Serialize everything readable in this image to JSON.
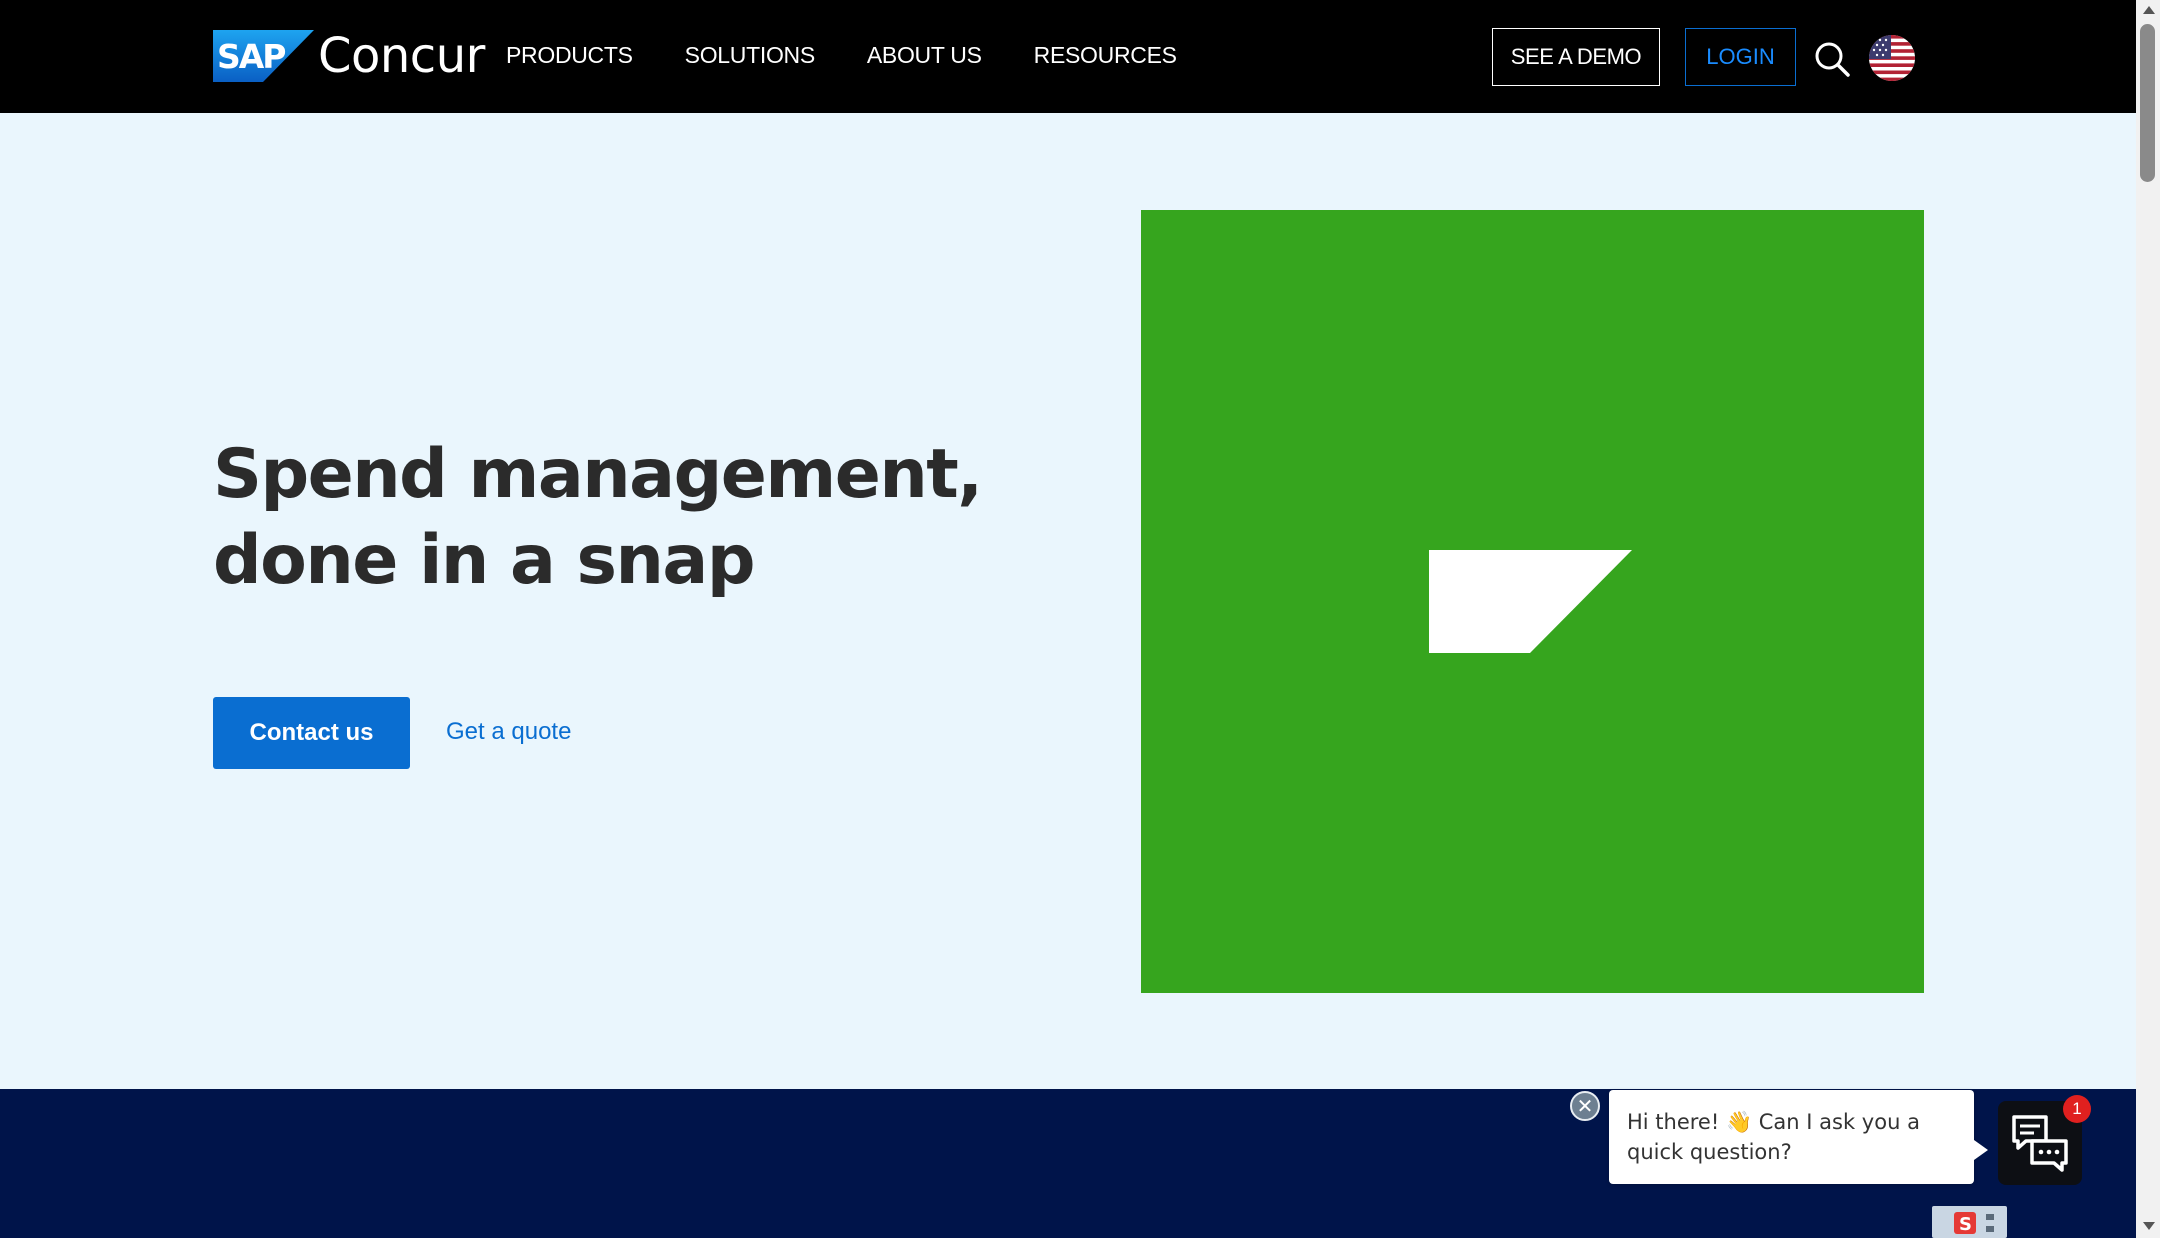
{
  "header": {
    "brand_sap": "SAP",
    "brand_name": "Concur",
    "nav": [
      {
        "label": "PRODUCTS"
      },
      {
        "label": "SOLUTIONS"
      },
      {
        "label": "ABOUT US"
      },
      {
        "label": "RESOURCES"
      }
    ],
    "demo_label": "SEE A DEMO",
    "login_label": "LOGIN",
    "search_icon": "search-icon",
    "region_icon": "us-flag-icon"
  },
  "hero": {
    "title_line1": "Spend management,",
    "title_line2": "done in a snap",
    "contact_label": "Contact us",
    "quote_label": "Get a quote",
    "image_color": "#36a51e"
  },
  "chat": {
    "greeting": "Hi there! 👋 Can I ask you a quick question?",
    "badge_count": "1",
    "close_icon": "close-icon",
    "launcher_icon": "chat-icon"
  },
  "colors": {
    "header_bg": "#000000",
    "hero_bg": "#eaf6fd",
    "accent": "#0a6ed1",
    "band_bg": "#00144a"
  }
}
